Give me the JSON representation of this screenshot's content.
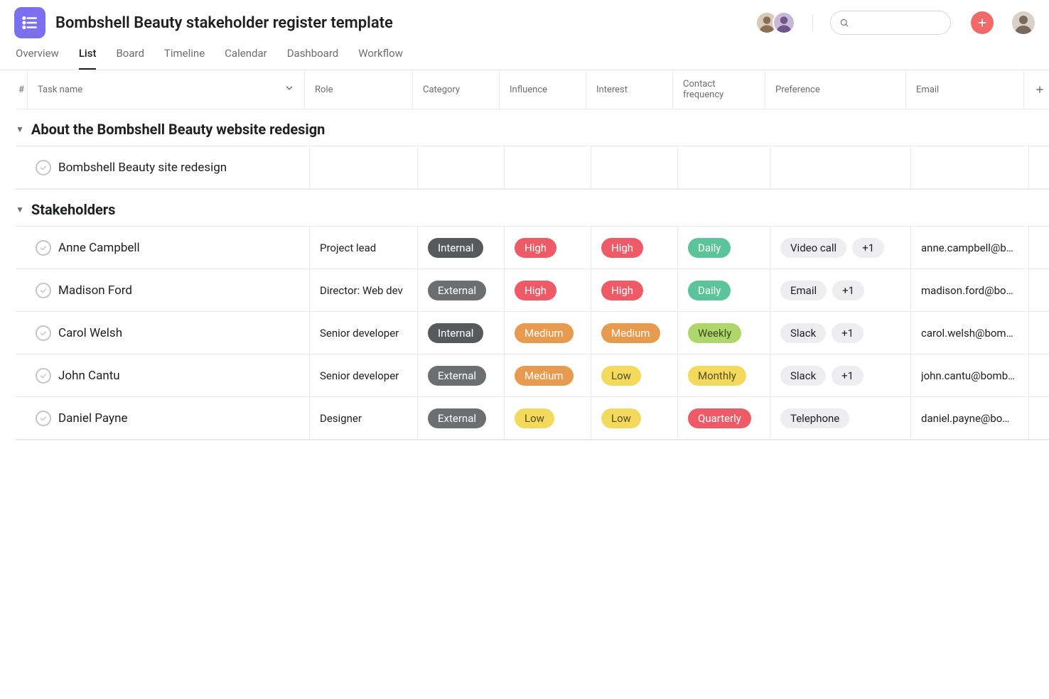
{
  "header": {
    "title": "Bombshell Beauty stakeholder register template",
    "search_placeholder": ""
  },
  "tabs": [
    "Overview",
    "List",
    "Board",
    "Timeline",
    "Calendar",
    "Dashboard",
    "Workflow"
  ],
  "active_tab": "List",
  "columns": {
    "hash": "#",
    "task": "Task name",
    "role": "Role",
    "category": "Category",
    "influence": "Influence",
    "interest": "Interest",
    "frequency": "Contact frequency",
    "preference": "Preference",
    "email": "Email"
  },
  "sections": [
    {
      "title": "About the Bombshell Beauty website redesign",
      "rows": [
        {
          "name": "Bombshell Beauty site redesign",
          "role": "",
          "category": "",
          "influence": "",
          "interest": "",
          "frequency": "",
          "preference": [],
          "email": ""
        }
      ]
    },
    {
      "title": "Stakeholders",
      "rows": [
        {
          "name": "Anne Campbell",
          "role": "Project lead",
          "category": "Internal",
          "influence": "High",
          "interest": "High",
          "frequency": "Daily",
          "preference": [
            "Video call",
            "+1"
          ],
          "email": "anne.campbell@bo..."
        },
        {
          "name": "Madison Ford",
          "role": "Director: Web dev",
          "category": "External",
          "influence": "High",
          "interest": "High",
          "frequency": "Daily",
          "preference": [
            "Email",
            "+1"
          ],
          "email": "madison.ford@bom..."
        },
        {
          "name": "Carol Welsh",
          "role": "Senior developer",
          "category": "Internal",
          "influence": "Medium",
          "interest": "Medium",
          "frequency": "Weekly",
          "preference": [
            "Slack",
            "+1"
          ],
          "email": "carol.welsh@bombs..."
        },
        {
          "name": "John Cantu",
          "role": "Senior developer",
          "category": "External",
          "influence": "Medium",
          "interest": "Low",
          "frequency": "Monthly",
          "preference": [
            "Slack",
            "+1"
          ],
          "email": "john.cantu@bombs..."
        },
        {
          "name": "Daniel Payne",
          "role": "Designer",
          "category": "External",
          "influence": "Low",
          "interest": "Low",
          "frequency": "Quarterly",
          "preference": [
            "Telephone"
          ],
          "email": "daniel.payne@bom..."
        }
      ]
    }
  ]
}
